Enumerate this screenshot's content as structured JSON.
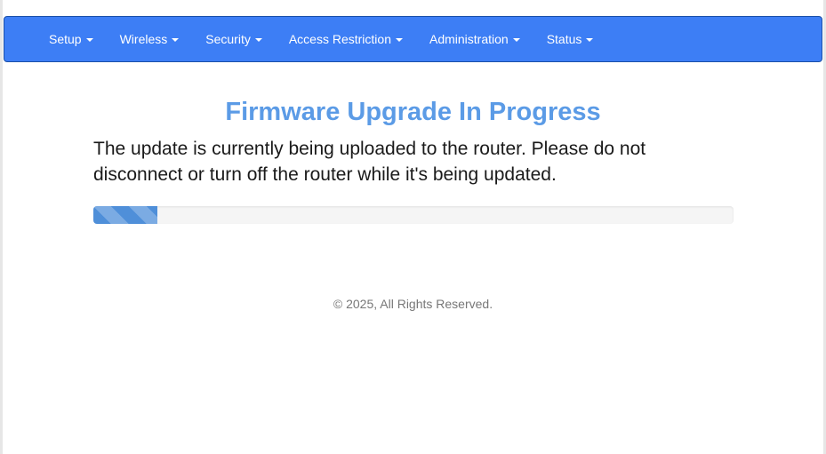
{
  "nav": {
    "items": [
      {
        "label": "Setup"
      },
      {
        "label": "Wireless"
      },
      {
        "label": "Security"
      },
      {
        "label": "Access Restriction"
      },
      {
        "label": "Administration"
      },
      {
        "label": "Status"
      }
    ]
  },
  "main": {
    "title": "Firmware Upgrade In Progress",
    "message": "The update is currently being uploaded to the router. Please do not disconnect or turn off the router while it's being updated.",
    "progress_percent": 10
  },
  "footer": {
    "copyright": "© 2025, All Rights Reserved."
  },
  "colors": {
    "navbar": "#3d7ef5",
    "title": "#5b9be6",
    "progress": "#4f8fd9"
  },
  "icons": {
    "dropdown": "caret-down-icon"
  }
}
